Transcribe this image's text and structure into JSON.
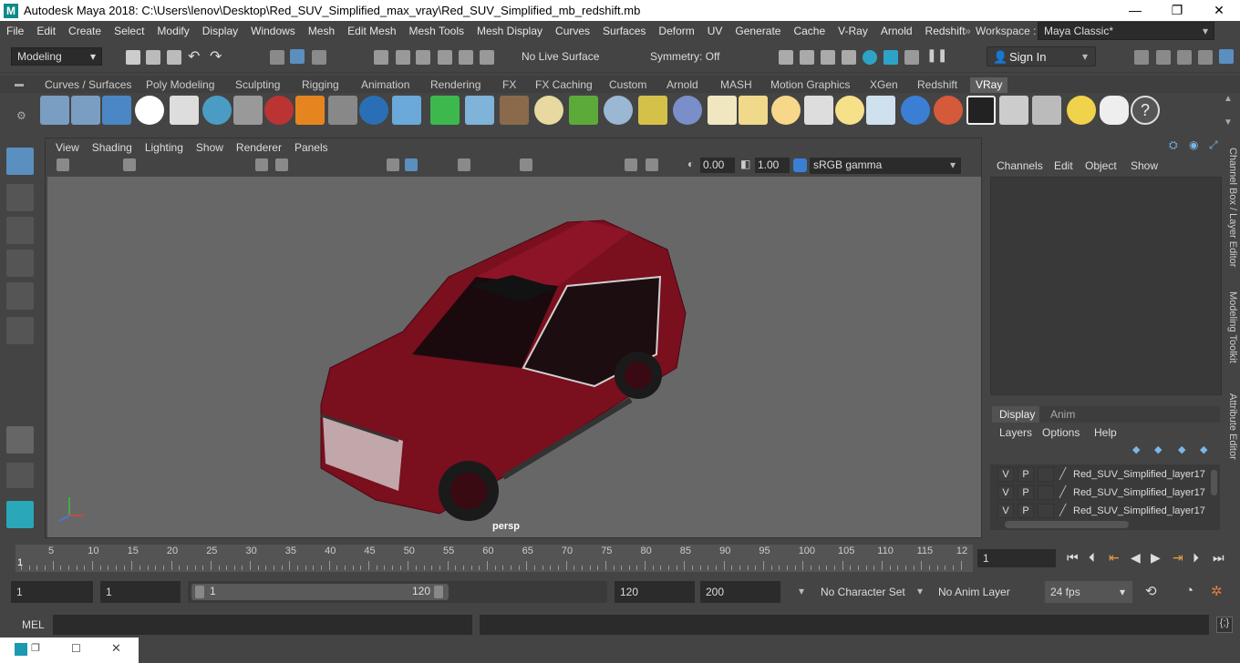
{
  "title_bar": {
    "text": "Autodesk Maya 2018: C:\\Users\\lenov\\Desktop\\Red_SUV_Simplified_max_vray\\Red_SUV_Simplified_mb_redshift.mb",
    "minimize": "—",
    "maximize": "❐",
    "close": "✕"
  },
  "menu": {
    "items": [
      "File",
      "Edit",
      "Create",
      "Select",
      "Modify",
      "Display",
      "Windows",
      "Mesh",
      "Edit Mesh",
      "Mesh Tools",
      "Mesh Display",
      "Curves",
      "Surfaces",
      "Deform",
      "UV",
      "Generate",
      "Cache",
      "V-Ray",
      "Arnold",
      "Redshift"
    ],
    "workspace_label": "Workspace :",
    "workspace_value": "Maya Classic*"
  },
  "status": {
    "menuset": "Modeling",
    "live_surface": "No Live Surface",
    "symmetry": "Symmetry: Off",
    "sign_in": "Sign In"
  },
  "shelf": {
    "tabs": [
      "Curves / Surfaces",
      "Poly Modeling",
      "Sculpting",
      "Rigging",
      "Animation",
      "Rendering",
      "FX",
      "FX Caching",
      "Custom",
      "Arnold",
      "MASH",
      "Motion Graphics",
      "XGen",
      "Redshift",
      "VRay"
    ],
    "active": "VRay"
  },
  "viewport": {
    "menus": [
      "View",
      "Shading",
      "Lighting",
      "Show",
      "Renderer",
      "Panels"
    ],
    "exposure": "0.00",
    "gamma": "1.00",
    "colorspace": "sRGB gamma",
    "camera_label": "persp"
  },
  "channel_box": {
    "menus": [
      "Channels",
      "Edit",
      "Object",
      "Show"
    ],
    "layer_tabs": [
      "Display",
      "Anim"
    ],
    "layer_menus": [
      "Layers",
      "Options",
      "Help"
    ],
    "layers": [
      {
        "v": "V",
        "p": "P",
        "name": "Red_SUV_Simplified_layer17"
      },
      {
        "v": "V",
        "p": "P",
        "name": "Red_SUV_Simplified_layer17"
      },
      {
        "v": "V",
        "p": "P",
        "name": "Red_SUV_Simplified_layer17"
      }
    ]
  },
  "side_tabs": [
    "Channel Box / Layer Editor",
    "Modeling Toolkit",
    "Attribute Editor"
  ],
  "timeline": {
    "ticks": [
      "5",
      "10",
      "15",
      "20",
      "25",
      "30",
      "35",
      "40",
      "45",
      "50",
      "55",
      "60",
      "65",
      "70",
      "75",
      "80",
      "85",
      "90",
      "95",
      "100",
      "105",
      "110",
      "115",
      "12"
    ],
    "start_marker": "1",
    "current_frame": "1"
  },
  "range": {
    "start": "1",
    "anim_start": "1",
    "slider_start": "1",
    "slider_end": "120",
    "end": "120",
    "anim_end": "200",
    "character_set": "No Character Set",
    "anim_layer": "No Anim Layer",
    "fps": "24 fps"
  },
  "command": {
    "label": "MEL"
  },
  "colors": {
    "car_body": "#7a0f1e",
    "viewport_bg": "#676767",
    "active_tab_bg": "#5d5d5d"
  }
}
